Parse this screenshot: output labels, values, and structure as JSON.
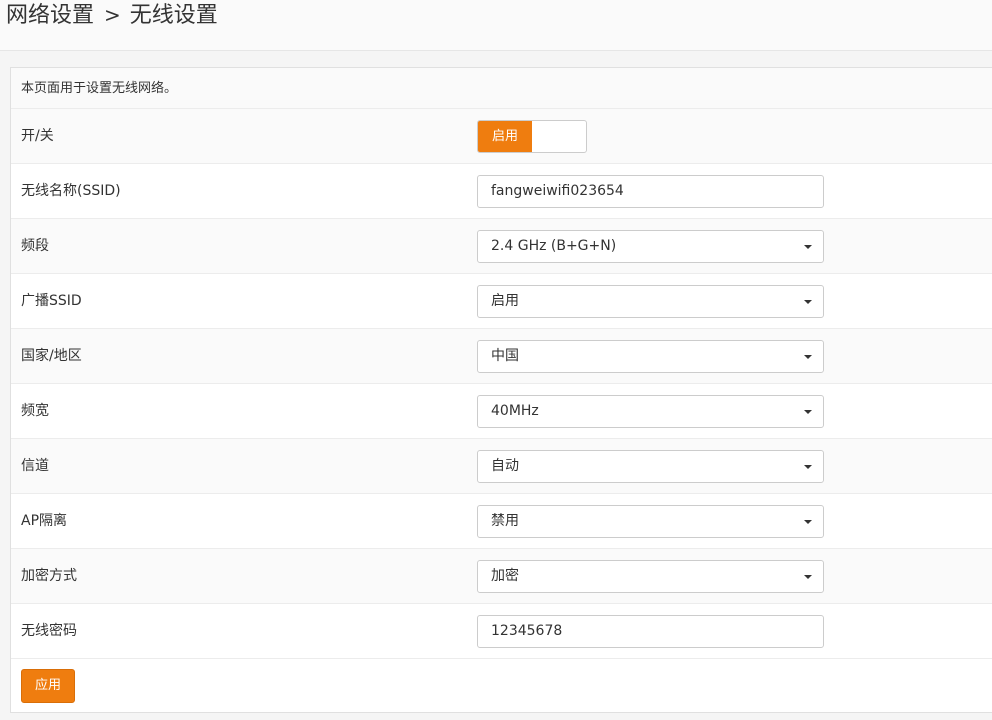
{
  "breadcrumb": {
    "parent": "网络设置",
    "separator": ">",
    "current": "无线设置"
  },
  "description": "本页面用于设置无线网络。",
  "form": {
    "power": {
      "label": "开/关",
      "value": "启用"
    },
    "ssid": {
      "label": "无线名称(SSID)",
      "value": "fangweiwifi023654"
    },
    "band": {
      "label": "频段",
      "value": "2.4 GHz (B+G+N)"
    },
    "broadcast": {
      "label": "广播SSID",
      "value": "启用"
    },
    "region": {
      "label": "国家/地区",
      "value": "中国"
    },
    "bandwidth": {
      "label": "频宽",
      "value": "40MHz"
    },
    "channel": {
      "label": "信道",
      "value": "自动"
    },
    "ap_isolation": {
      "label": "AP隔离",
      "value": "禁用"
    },
    "encryption": {
      "label": "加密方式",
      "value": "加密"
    },
    "password": {
      "label": "无线密码",
      "value": "12345678"
    }
  },
  "apply_label": "应用",
  "colors": {
    "accent": "#ef7d0f",
    "row_alt": "#fafafa",
    "border": "#cccccc"
  }
}
